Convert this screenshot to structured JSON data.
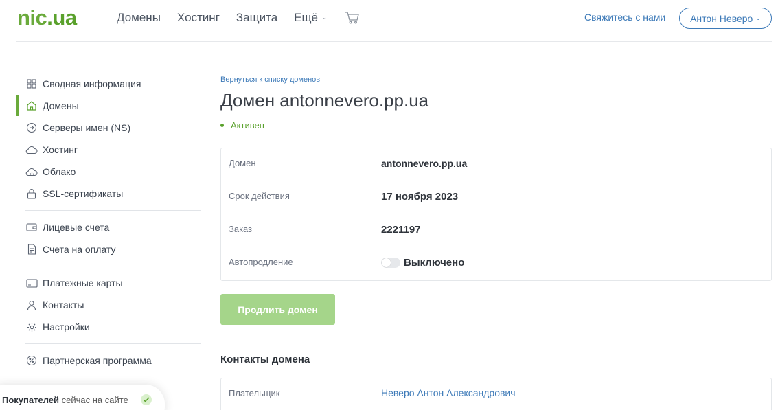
{
  "header": {
    "logo_part1": "nic",
    "logo_part2": ".ua",
    "nav": [
      {
        "label": "Домены"
      },
      {
        "label": "Хостинг"
      },
      {
        "label": "Защита"
      },
      {
        "label": "Ещё"
      }
    ],
    "contact_label": "Свяжитесь с нами",
    "user_label": "Антон Неверо"
  },
  "sidebar": {
    "groups": [
      [
        {
          "label": "Сводная информация",
          "icon": "grid-icon"
        },
        {
          "label": "Домены",
          "icon": "home-icon",
          "active": true
        },
        {
          "label": "Серверы имен (NS)",
          "icon": "arrow-circle-icon"
        },
        {
          "label": "Хостинг",
          "icon": "cloud-icon"
        },
        {
          "label": "Облако",
          "icon": "cloud-chart-icon"
        },
        {
          "label": "SSL-сертификаты",
          "icon": "lock-icon"
        }
      ],
      [
        {
          "label": "Лицевые счета",
          "icon": "wallet-icon"
        },
        {
          "label": "Счета на оплату",
          "icon": "document-icon"
        }
      ],
      [
        {
          "label": "Платежные карты",
          "icon": "card-icon"
        },
        {
          "label": "Контакты",
          "icon": "user-icon"
        },
        {
          "label": "Настройки",
          "icon": "gear-icon"
        }
      ],
      [
        {
          "label": "Партнерская программа",
          "icon": "percent-icon"
        }
      ]
    ]
  },
  "main": {
    "back_link": "Вернуться к списку доменов",
    "title": "Домен antonnevero.pp.ua",
    "status": "Активен",
    "status_color": "#5aa12c",
    "rows": [
      {
        "key": "Домен",
        "value": "antonnevero.pp.ua"
      },
      {
        "key": "Срок действия",
        "value": "17 ноября 2023"
      },
      {
        "key": "Заказ",
        "value": "2221197"
      },
      {
        "key": "Автопродление",
        "value": "Выключено"
      }
    ],
    "renew_button": "Продлить домен",
    "contacts_title": "Контакты домена",
    "contacts": [
      {
        "key": "Плательщик",
        "value": "Неверо Антон Александрович"
      }
    ]
  },
  "widget": {
    "bold": "Покупателей",
    "rest": " сейчас на сайте"
  },
  "colors": {
    "brand_green": "#6aaa3b",
    "link_blue": "#3d7ab8",
    "button_green": "#a5d58a"
  }
}
